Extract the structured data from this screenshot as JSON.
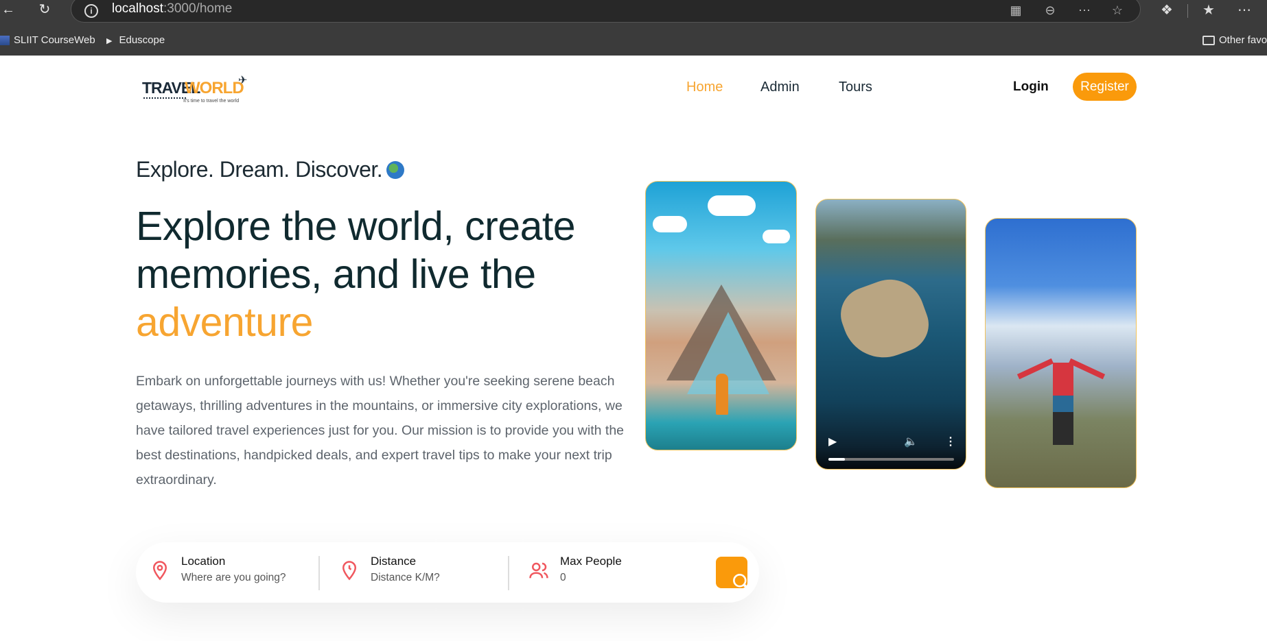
{
  "browser": {
    "url_host": "localhost",
    "url_rest": ":3000/home",
    "bookmarks": [
      {
        "label": "SLIIT CourseWeb"
      },
      {
        "label": "Eduscope"
      }
    ],
    "other_favorites": "Other favo"
  },
  "site": {
    "logo": {
      "travel": "TRAVEL",
      "world": "WORLD",
      "tagline": "It's time to travel the world"
    },
    "nav": [
      {
        "label": "Home",
        "active": true
      },
      {
        "label": "Admin",
        "active": false
      },
      {
        "label": "Tours",
        "active": false
      }
    ],
    "login_label": "Login",
    "register_label": "Register"
  },
  "hero": {
    "subtitle": "Explore. Dream. Discover.",
    "headline_part1": "Explore the world, create memories, and live the ",
    "headline_highlight": "adventure",
    "description": "Embark on unforgettable journeys with us! Whether you're seeking serene beach getaways, thrilling adventures in the mountains, or immersive city explorations, we have tailored travel experiences just for you. Our mission is to provide you with the best destinations, handpicked deals, and expert travel tips to make your next trip extraordinary.",
    "video_progress": 0.13
  },
  "search": {
    "location": {
      "label": "Location",
      "placeholder": "Where are you going?"
    },
    "distance": {
      "label": "Distance",
      "placeholder": "Distance K/M?"
    },
    "max_people": {
      "label": "Max People",
      "value": "0"
    }
  },
  "colors": {
    "accent": "#fa9a0b",
    "highlight": "#f7a531",
    "icon": "#f0575e"
  }
}
